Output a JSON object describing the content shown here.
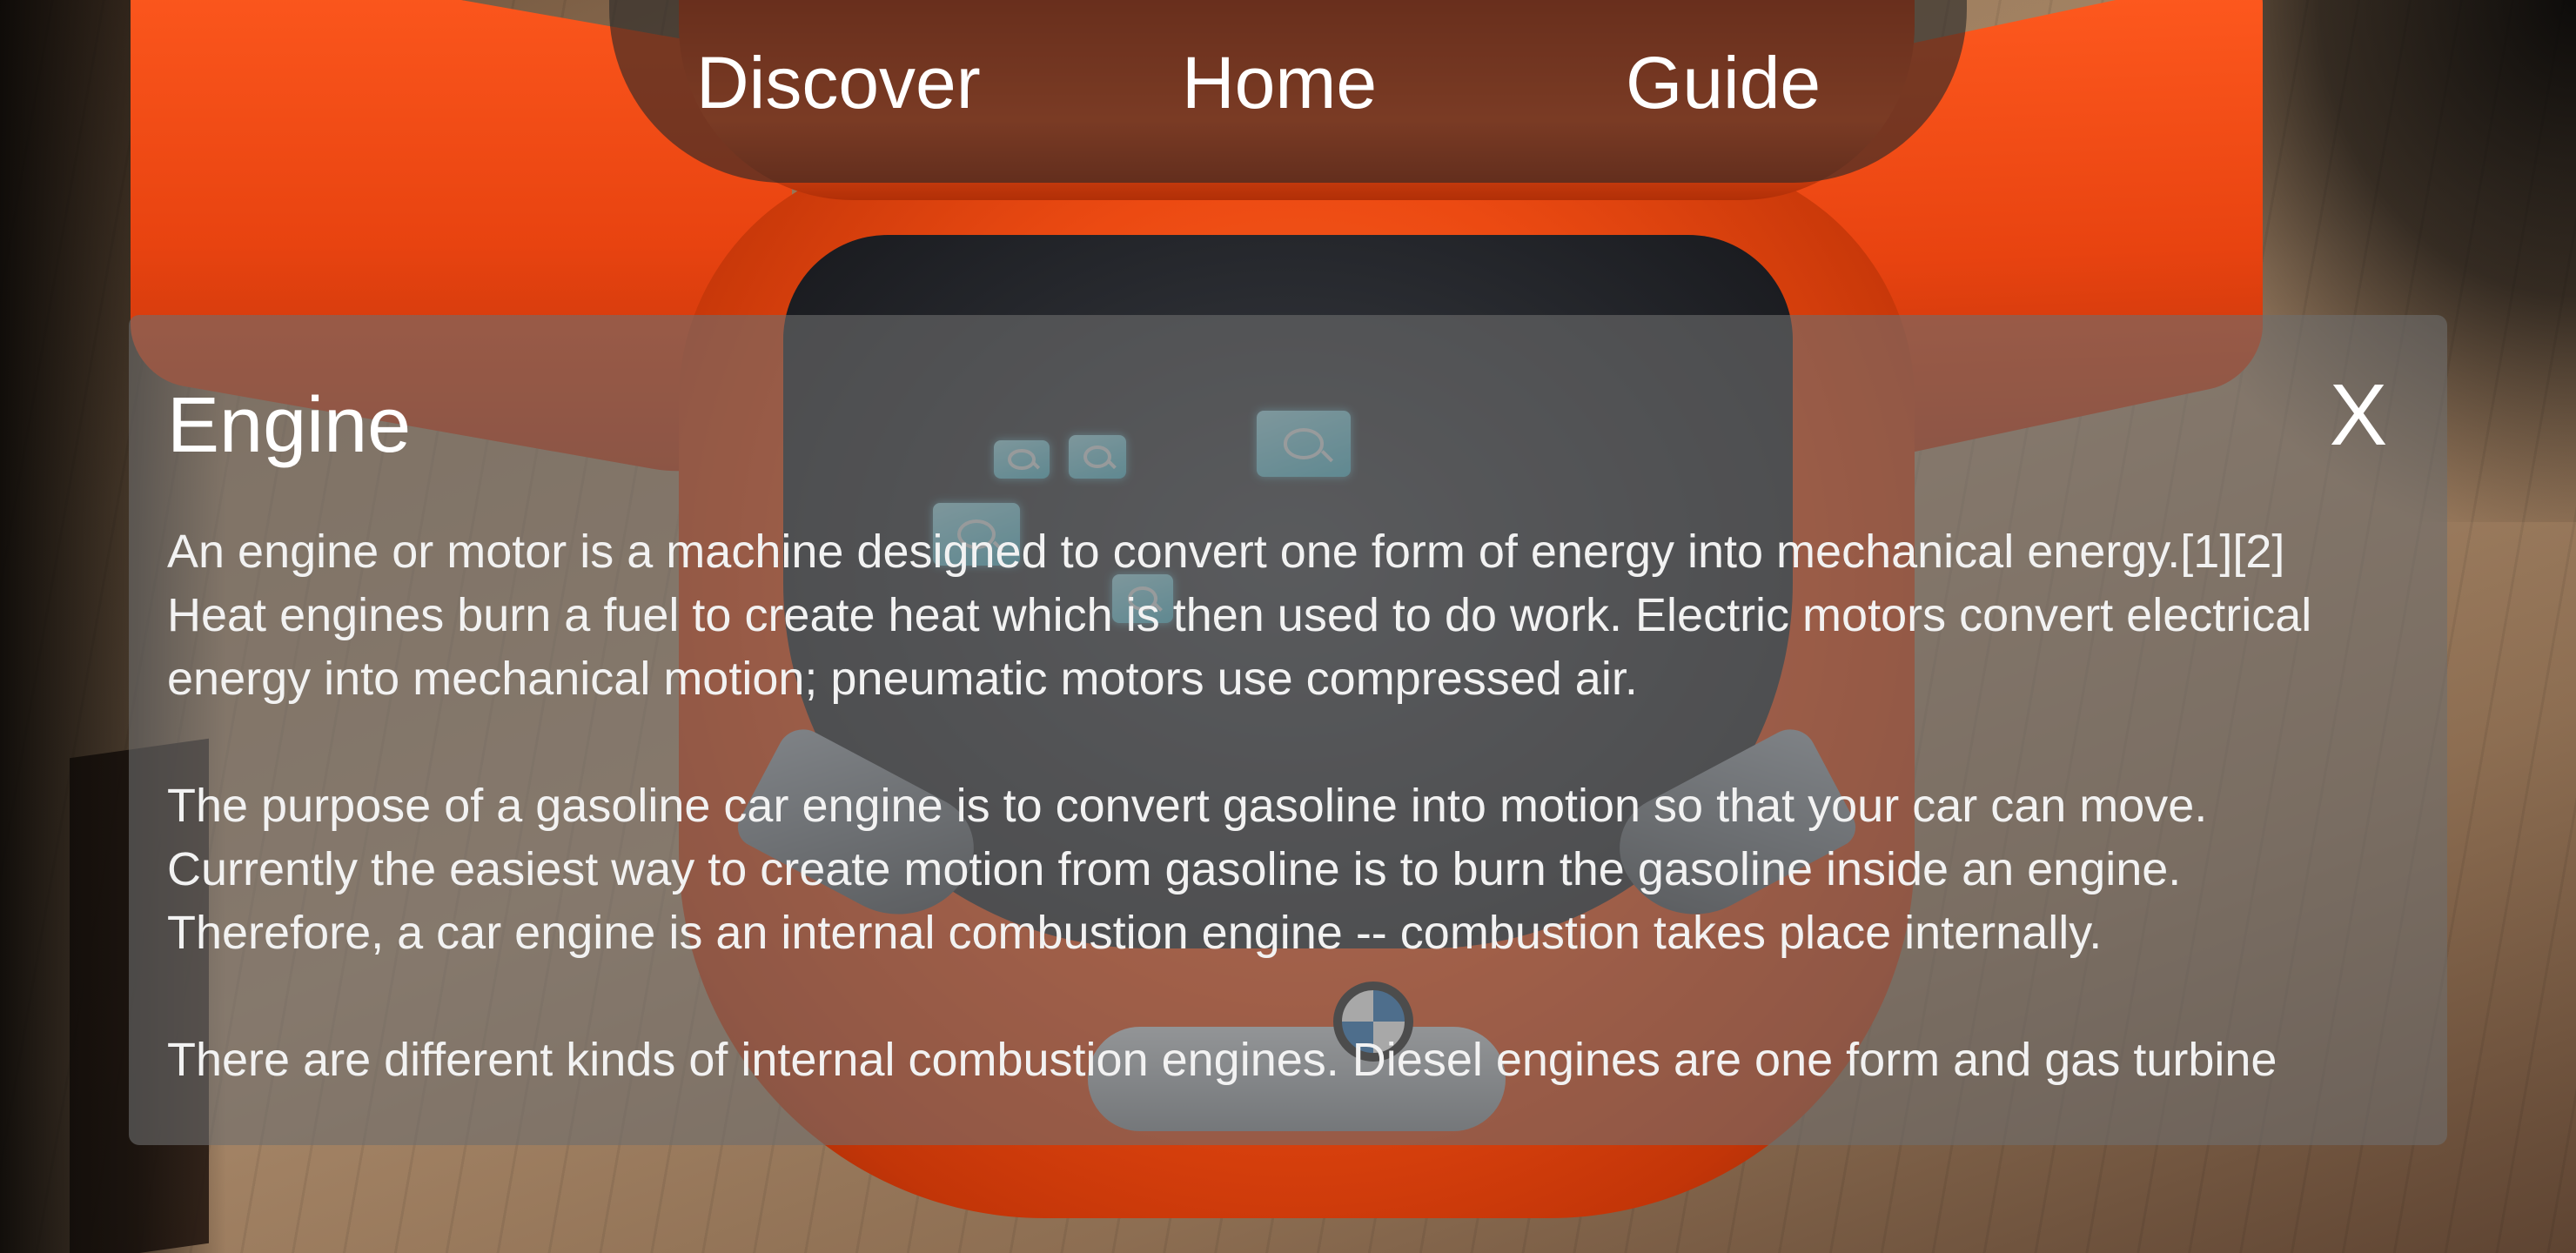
{
  "nav": {
    "discover_label": "Discover",
    "home_label": "Home",
    "guide_label": "Guide"
  },
  "panel": {
    "title": "Engine",
    "close_label": "X",
    "paragraphs": [
      "An engine or motor is a machine designed to convert one form of energy into mechanical energy.[1][2]\nHeat engines burn a fuel to create heat which is then used to do work. Electric motors convert electrical\nenergy into mechanical motion; pneumatic motors use compressed air.",
      "The purpose of a gasoline car engine is to convert gasoline into motion so that your car can move.\nCurrently the easiest way to create motion from gasoline is to burn the gasoline inside an engine.\nTherefore, a car engine is an internal combustion engine -- combustion takes place internally.",
      "There are different kinds of internal combustion engines. Diesel engines are one form and gas turbine"
    ]
  },
  "scene": {
    "car_color": "#e84310",
    "hotspot_color": "#5fd0e4",
    "hotspot_icon": "magnifier-icon"
  }
}
